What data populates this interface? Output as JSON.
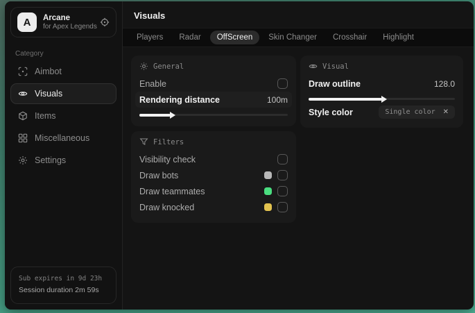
{
  "colors": {
    "swatch_bots": "#b8b8b8",
    "swatch_teammates": "#4ade80",
    "swatch_knocked": "#e2c24f",
    "slider_fill": "#f2f2f2"
  },
  "sidebar": {
    "logo_letter": "A",
    "app_name": "Arcane",
    "app_subtitle": "for Apex Legends",
    "category_label": "Category",
    "items": [
      {
        "label": "Aimbot",
        "icon": "scan-icon"
      },
      {
        "label": "Visuals",
        "icon": "eye-icon"
      },
      {
        "label": "Items",
        "icon": "cube-icon"
      },
      {
        "label": "Miscellaneous",
        "icon": "grid-icon"
      },
      {
        "label": "Settings",
        "icon": "gear-icon"
      }
    ],
    "footer": {
      "sub_expires": "Sub expires in 9d 23h",
      "session_duration": "Session duration 2m 59s"
    }
  },
  "main": {
    "title": "Visuals",
    "active_tab": "OffScreen",
    "tabs": [
      {
        "label": "Players"
      },
      {
        "label": "Radar"
      },
      {
        "label": "OffScreen"
      },
      {
        "label": "Skin Changer"
      },
      {
        "label": "Crosshair"
      },
      {
        "label": "Highlight"
      }
    ],
    "general": {
      "title": "General",
      "enable_label": "Enable",
      "enable_checked": false,
      "rendering_label": "Rendering distance",
      "rendering_value": "100m",
      "rendering_percent": 21
    },
    "filters": {
      "title": "Filters",
      "rows": [
        {
          "label": "Visibility check",
          "checked": false
        },
        {
          "label": "Draw bots",
          "checked": false
        },
        {
          "label": "Draw teammates",
          "checked": false
        },
        {
          "label": "Draw knocked",
          "checked": false
        }
      ]
    },
    "visual": {
      "title": "Visual",
      "outline_label": "Draw outline",
      "outline_value": "128.0",
      "outline_percent": 50,
      "style_label": "Style color",
      "style_chip": "Single color",
      "chip_close": "✕"
    }
  }
}
